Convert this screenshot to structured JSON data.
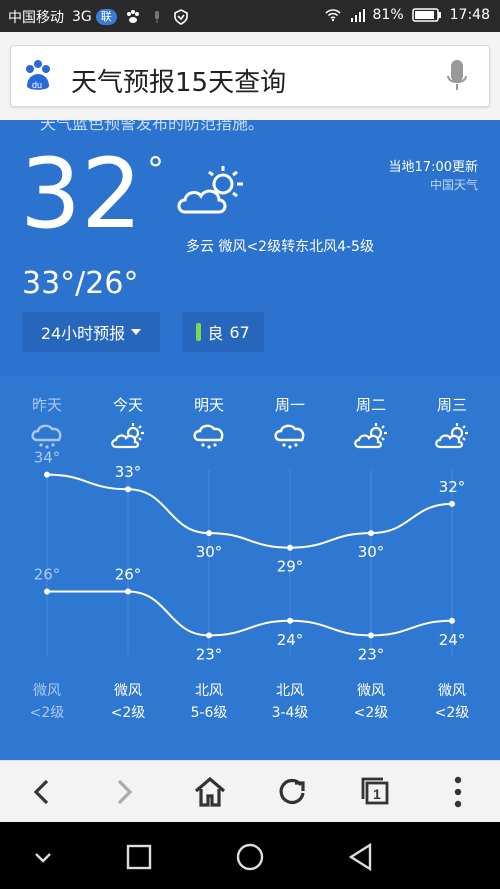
{
  "statusbar": {
    "carrier": "中国移动",
    "network": "3G",
    "network_badge": "联",
    "battery": "81%",
    "time": "17:48"
  },
  "browser": {
    "search_text": "天气预报15天查询"
  },
  "weather": {
    "peek_text": "天气蓝色预警发布的防范措施。",
    "current_temp": "32",
    "degree_symbol": "°",
    "update_text": "当地17:00更新",
    "source": "中国天气",
    "description": "多云  微风<2级转东北风4-5级",
    "range": "33°/26°",
    "forecast_button": "24小时预报",
    "aqi_label": "良",
    "aqi_value": "67",
    "days": [
      {
        "name": "昨天",
        "icon": "rain-icon",
        "high": "34°",
        "low": "26°",
        "wind_dir": "微风",
        "wind_level": "<2级",
        "dim": true
      },
      {
        "name": "今天",
        "icon": "partly-cloudy-icon",
        "high": "33°",
        "low": "26°",
        "wind_dir": "微风",
        "wind_level": "<2级",
        "dim": false
      },
      {
        "name": "明天",
        "icon": "rain-icon",
        "high": "30°",
        "low": "23°",
        "wind_dir": "北风",
        "wind_level": "5-6级",
        "dim": false
      },
      {
        "name": "周一",
        "icon": "rain-icon",
        "high": "29°",
        "low": "24°",
        "wind_dir": "北风",
        "wind_level": "3-4级",
        "dim": false
      },
      {
        "name": "周二",
        "icon": "partly-cloudy-icon",
        "high": "30°",
        "low": "23°",
        "wind_dir": "微风",
        "wind_level": "<2级",
        "dim": false
      },
      {
        "name": "周三",
        "icon": "partly-cloudy-icon",
        "high": "32°",
        "low": "24°",
        "wind_dir": "微风",
        "wind_level": "<2级",
        "dim": false
      }
    ]
  },
  "chart_data": {
    "type": "line",
    "categories": [
      "昨天",
      "今天",
      "明天",
      "周一",
      "周二",
      "周三"
    ],
    "series": [
      {
        "values": [
          34,
          33,
          30,
          29,
          30,
          32
        ]
      },
      {
        "values": [
          26,
          26,
          23,
          24,
          23,
          24
        ]
      }
    ]
  },
  "navbar": {
    "tabs_count": "1"
  }
}
